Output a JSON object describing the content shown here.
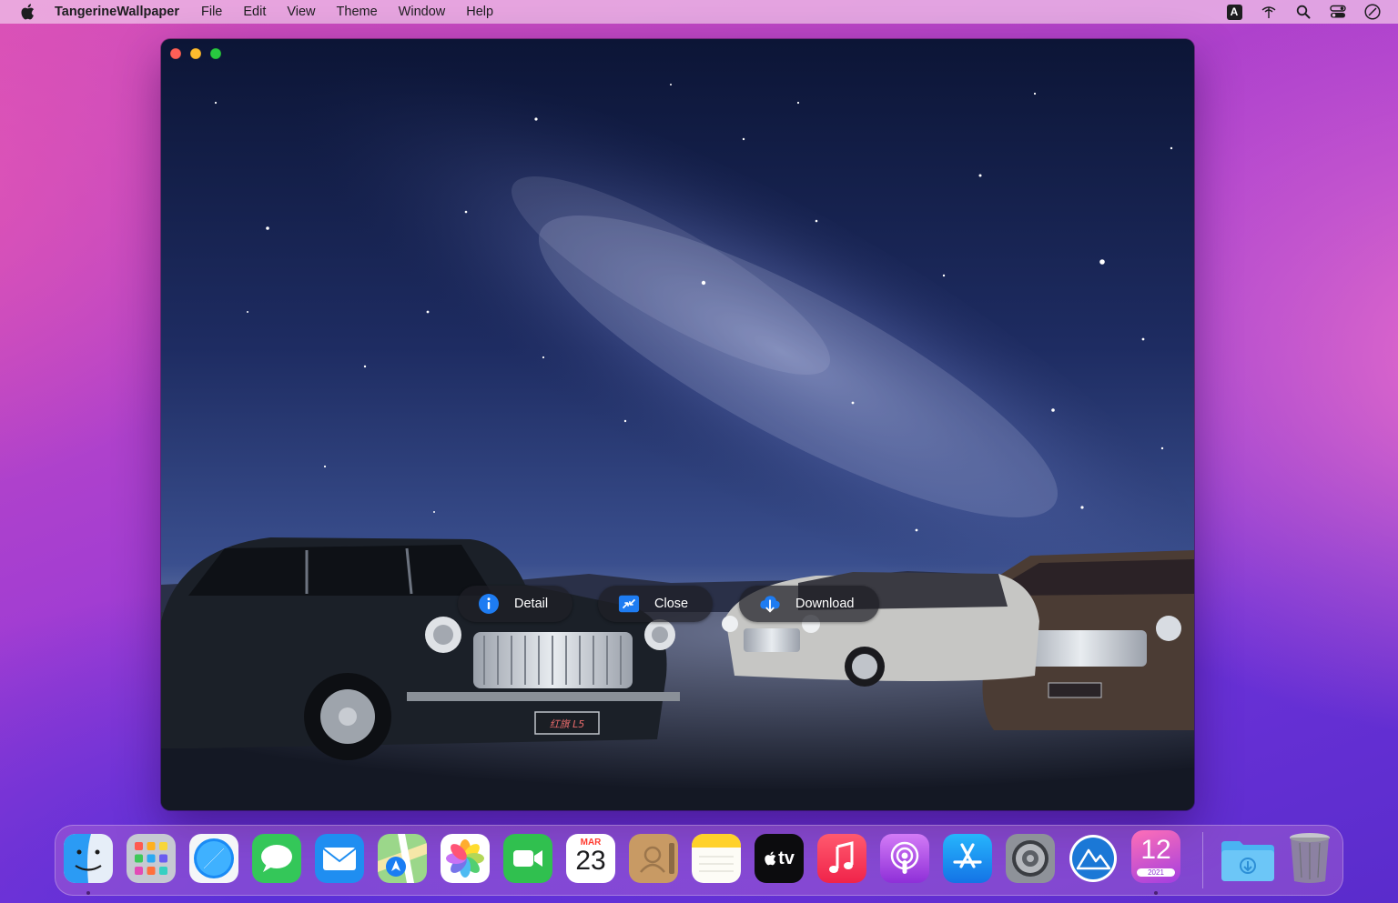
{
  "menubar": {
    "app_name": "TangerineWallpaper",
    "menus": [
      "File",
      "Edit",
      "View",
      "Theme",
      "Window",
      "Help"
    ],
    "status_icons": [
      "input-source-icon",
      "airdrop-icon",
      "spotlight-icon",
      "control-center-icon",
      "siri-icon"
    ],
    "input_source_label": "A"
  },
  "window": {
    "buttons": {
      "detail_label": "Detail",
      "close_label": "Close",
      "download_label": "Download"
    },
    "wallpaper_plate": "红旗 L5"
  },
  "dock": {
    "items": [
      {
        "name": "finder-icon",
        "running": true
      },
      {
        "name": "launchpad-icon",
        "running": false
      },
      {
        "name": "safari-icon",
        "running": false
      },
      {
        "name": "messages-icon",
        "running": false
      },
      {
        "name": "mail-icon",
        "running": false
      },
      {
        "name": "maps-icon",
        "running": false
      },
      {
        "name": "photos-icon",
        "running": false
      },
      {
        "name": "facetime-icon",
        "running": false
      },
      {
        "name": "calendar-icon",
        "running": false
      },
      {
        "name": "contacts-icon",
        "running": false
      },
      {
        "name": "notes-icon",
        "running": false
      },
      {
        "name": "apple-tv-icon",
        "running": false
      },
      {
        "name": "music-icon",
        "running": false
      },
      {
        "name": "podcasts-icon",
        "running": false
      },
      {
        "name": "app-store-icon",
        "running": false
      },
      {
        "name": "system-preferences-icon",
        "running": false
      },
      {
        "name": "macos-server-icon",
        "running": false
      },
      {
        "name": "monterey-icon",
        "running": true
      },
      {
        "name": "downloads-folder-icon",
        "running": false
      },
      {
        "name": "trash-icon",
        "running": false
      }
    ],
    "calendar": {
      "month": "MAR",
      "day": "23"
    },
    "tv_label": "tv",
    "monterey": {
      "number": "12",
      "year": "2021"
    }
  },
  "colors": {
    "menubar_bg": "#eebee8",
    "button_bg": "#1e1e26",
    "accent_blue": "#1e7cf2"
  }
}
